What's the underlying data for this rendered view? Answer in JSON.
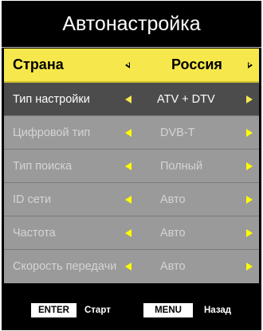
{
  "title": "Автонастройка",
  "rows": [
    {
      "label": "Страна",
      "value": "Россия",
      "state": "selected"
    },
    {
      "label": "Тип настройки",
      "value": "ATV + DTV",
      "state": "active"
    },
    {
      "label": "Цифровой тип",
      "value": "DVB-T",
      "state": "disabled"
    },
    {
      "label": "Тип поиска",
      "value": "Полный",
      "state": "disabled"
    },
    {
      "label": "ID сети",
      "value": "Авто",
      "state": "disabled"
    },
    {
      "label": "Частота",
      "value": "Авто",
      "state": "disabled"
    },
    {
      "label": "Скорость передачи",
      "value": "Авто",
      "state": "disabled"
    }
  ],
  "footer": {
    "enter_key": "ENTER",
    "enter_desc": "Старт",
    "menu_key": "MENU",
    "menu_desc": "Назад"
  },
  "colors": {
    "highlight": "#f6e84c",
    "arrow": "#ffff00",
    "active_row": "#4c4c4c",
    "disabled_row": "#9a9a9a",
    "background": "#000000"
  },
  "icons": {
    "left": "triangle-left-icon",
    "right": "triangle-right-icon"
  }
}
